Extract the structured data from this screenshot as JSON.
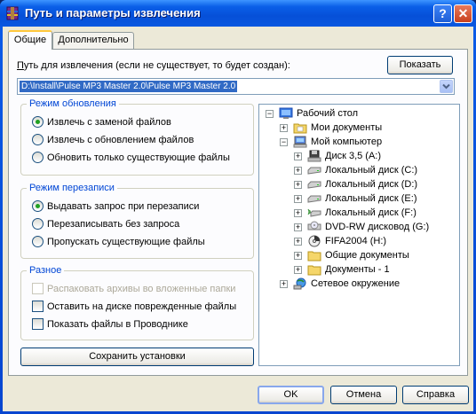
{
  "window": {
    "title": "Путь и параметры извлечения",
    "help_glyph": "?",
    "close_glyph": "✕"
  },
  "tabs": [
    {
      "label": "Общие",
      "active": true
    },
    {
      "label": "Дополнительно",
      "active": false
    }
  ],
  "path": {
    "label_u": "П",
    "label_rest": "уть для извлечения (если не существует, то будет создан):",
    "show_button": "Показать",
    "show_button_u": "а",
    "value": "D:\\Install\\Pulse MP3 Master 2.0\\Pulse MP3 Master 2.0"
  },
  "update_mode": {
    "title": "Режим обновления",
    "options": [
      {
        "label": "Извлечь с заменой файлов",
        "checked": true
      },
      {
        "label": "Извлечь с обновлением файлов",
        "checked": false
      },
      {
        "label": "Обновить только существующие файлы",
        "checked": false
      }
    ]
  },
  "overwrite_mode": {
    "title": "Режим перезаписи",
    "options": [
      {
        "label": "Выдавать запрос при перезаписи",
        "checked": true
      },
      {
        "label": "Перезаписывать без запроса",
        "checked": false
      },
      {
        "label": "Пропускать существующие файлы",
        "checked": false
      }
    ]
  },
  "misc": {
    "title": "Разное",
    "options": [
      {
        "label": "Распаковать архивы во вложенные папки",
        "checked": false,
        "disabled": true
      },
      {
        "label": "Оставить на диске поврежденные файлы",
        "checked": false,
        "disabled": false
      },
      {
        "label": "Показать файлы в Проводнике",
        "checked": false,
        "disabled": false
      }
    ]
  },
  "save_button": "Сохранить установки",
  "tree": {
    "items": [
      {
        "label": "Рабочий стол",
        "icon": "desktop-icon",
        "expander": "−"
      },
      {
        "label": "Мои документы",
        "icon": "folder-icon",
        "expander": "+"
      },
      {
        "label": "Мой компьютер",
        "icon": "computer-icon",
        "expander": "−"
      },
      {
        "label": "Диск 3,5 (A:)",
        "icon": "floppy-icon",
        "expander": "+"
      },
      {
        "label": "Локальный диск (C:)",
        "icon": "hard-drive-icon",
        "expander": "+"
      },
      {
        "label": "Локальный диск (D:)",
        "icon": "hard-drive-icon",
        "expander": "+"
      },
      {
        "label": "Локальный диск (E:)",
        "icon": "hard-drive-icon",
        "expander": "+"
      },
      {
        "label": "Локальный диск (F:)",
        "icon": "removable-drive-icon",
        "expander": "+"
      },
      {
        "label": "DVD-RW дисковод (G:)",
        "icon": "dvd-drive-icon",
        "expander": "+"
      },
      {
        "label": "FIFA2004 (H:)",
        "icon": "cd-icon",
        "expander": "+"
      },
      {
        "label": "Общие документы",
        "icon": "folder-icon",
        "expander": "+"
      },
      {
        "label": "Документы - 1",
        "icon": "folder-icon",
        "expander": "+"
      },
      {
        "label": "Сетевое окружение",
        "icon": "network-icon",
        "expander": "+"
      }
    ]
  },
  "buttons": {
    "ok": "OK",
    "cancel": "Отмена",
    "help": "Справка"
  }
}
